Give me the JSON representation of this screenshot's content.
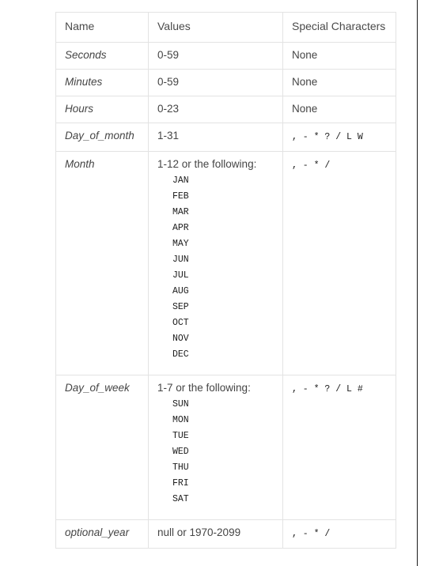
{
  "table": {
    "headers": [
      "Name",
      "Values",
      "Special Characters"
    ],
    "rows": [
      {
        "name": "Seconds",
        "values": "0-59",
        "list": [],
        "special": "None",
        "special_mono": false
      },
      {
        "name": "Minutes",
        "values": "0-59",
        "list": [],
        "special": "None",
        "special_mono": false
      },
      {
        "name": "Hours",
        "values": "0-23",
        "list": [],
        "special": "None",
        "special_mono": false
      },
      {
        "name": "Day_of_month",
        "values": "1-31",
        "list": [],
        "special": ", - * ? / L W",
        "special_mono": true
      },
      {
        "name": "Month",
        "values": "1-12 or the following:",
        "list": [
          "JAN",
          "FEB",
          "MAR",
          "APR",
          "MAY",
          "JUN",
          "JUL",
          "AUG",
          "SEP",
          "OCT",
          "NOV",
          "DEC"
        ],
        "special": ", - * /",
        "special_mono": true
      },
      {
        "name": "Day_of_week",
        "values": "1-7 or the following:",
        "list": [
          "SUN",
          "MON",
          "TUE",
          "WED",
          "THU",
          "FRI",
          "SAT"
        ],
        "special": ", - * ? / L #",
        "special_mono": true
      },
      {
        "name": "optional_year",
        "values": "null or 1970-2099",
        "list": [],
        "special": ", - * /",
        "special_mono": true
      }
    ]
  },
  "colors": {
    "text": "#454545",
    "mono_text": "#1c1c1c",
    "border": "#e3e3e3",
    "background": "#ffffff",
    "edge_rule": "#1b1b1b"
  }
}
